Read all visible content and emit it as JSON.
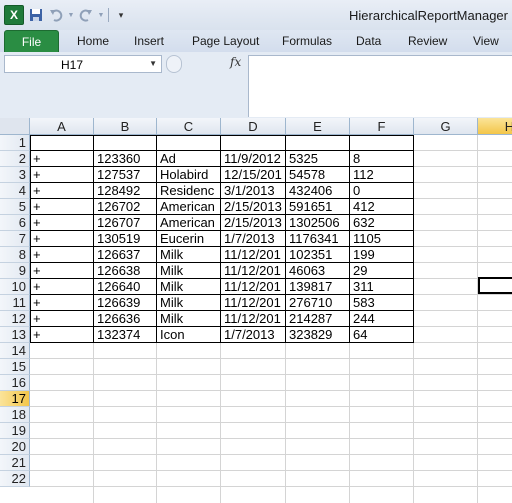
{
  "title_bar": {
    "app_icon": "X",
    "save_icon": "save-icon",
    "undo_icon": "undo-icon",
    "redo_icon": "redo-icon",
    "customize_icon": "customize-qat-icon",
    "title": "HierarchicalReportManager"
  },
  "tabs": [
    "File",
    "Home",
    "Insert",
    "Page Layout",
    "Formulas",
    "Data",
    "Review",
    "View"
  ],
  "name_box": {
    "value": "H17"
  },
  "formula_bar": {
    "fx_label": "fx",
    "value": ""
  },
  "columns": [
    "A",
    "B",
    "C",
    "D",
    "E",
    "F",
    "G",
    "H"
  ],
  "active_column": "H",
  "rows": [
    "1",
    "2",
    "3",
    "4",
    "5",
    "6",
    "7",
    "8",
    "9",
    "10",
    "11",
    "12",
    "13",
    "14",
    "15",
    "16",
    "17",
    "18",
    "19",
    "20",
    "21",
    "22"
  ],
  "active_row": "17",
  "table": [
    [
      "+",
      "123360",
      "Ad",
      "11/9/2012",
      "5325",
      "8"
    ],
    [
      "+",
      "127537",
      "Holabird",
      "12/15/201",
      "54578",
      "112"
    ],
    [
      "+",
      "128492",
      "Residenc",
      "3/1/2013",
      "432406",
      "0"
    ],
    [
      "+",
      "126702",
      "American",
      "2/15/2013",
      "591651",
      "412"
    ],
    [
      "+",
      "126707",
      "American",
      "2/15/2013",
      "1302506",
      "632"
    ],
    [
      "+",
      "130519",
      "Eucerin",
      "1/7/2013",
      "1176341",
      "1105"
    ],
    [
      "+",
      "126637",
      "Milk",
      "11/12/201",
      "102351",
      "199"
    ],
    [
      "+",
      "126638",
      "Milk",
      "11/12/201",
      "46063",
      "29"
    ],
    [
      "+",
      "126640",
      "Milk",
      "11/12/201",
      "139817",
      "311"
    ],
    [
      "+",
      "126639",
      "Milk",
      "11/12/201",
      "276710",
      "583"
    ],
    [
      "+",
      "126636",
      "Milk",
      "11/12/201",
      "214287",
      "244"
    ],
    [
      "+",
      "132374",
      "Icon",
      "1/7/2013",
      "323829",
      "64"
    ]
  ]
}
